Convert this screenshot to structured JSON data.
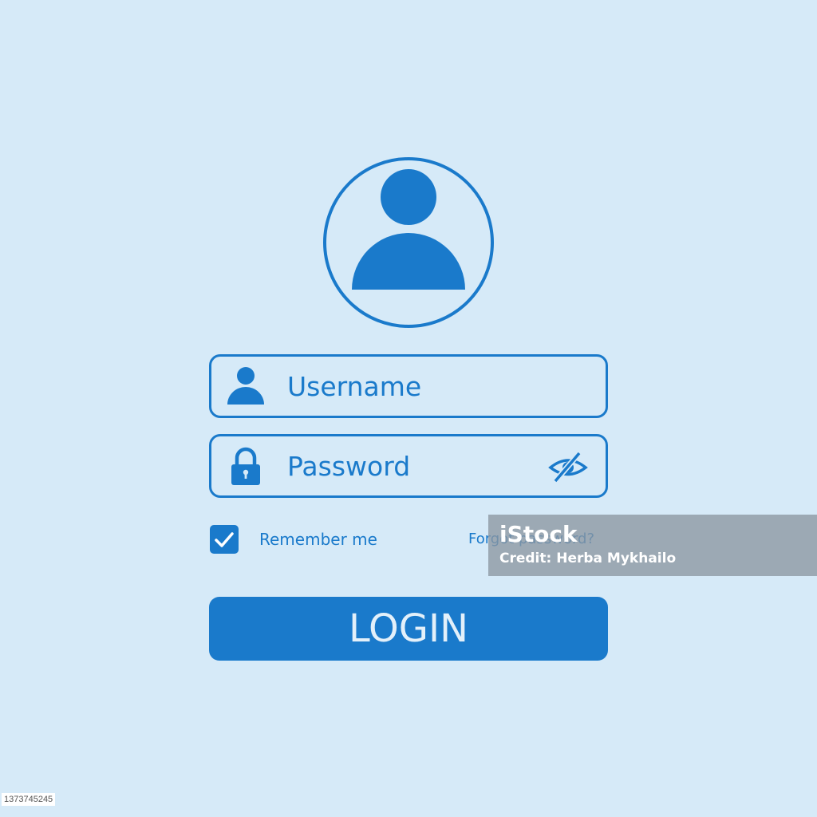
{
  "form": {
    "username_placeholder": "Username",
    "password_placeholder": "Password",
    "remember_label": "Remember me",
    "remember_checked": true,
    "forgot_link": "Forgot password?",
    "login_label": "LOGIN"
  },
  "icons": {
    "avatar": "user-avatar-icon",
    "username": "user-icon",
    "password": "lock-icon",
    "visibility": "eye-slash-icon",
    "checkbox": "checkmark-icon"
  },
  "watermark": {
    "logo": "iStock",
    "credit": "Credit: Herba Mykhailo"
  },
  "stock_id": "1373745245",
  "colors": {
    "background": "#d6eaf8",
    "accent": "#1a7acb",
    "button_text": "#e3f0fa"
  }
}
